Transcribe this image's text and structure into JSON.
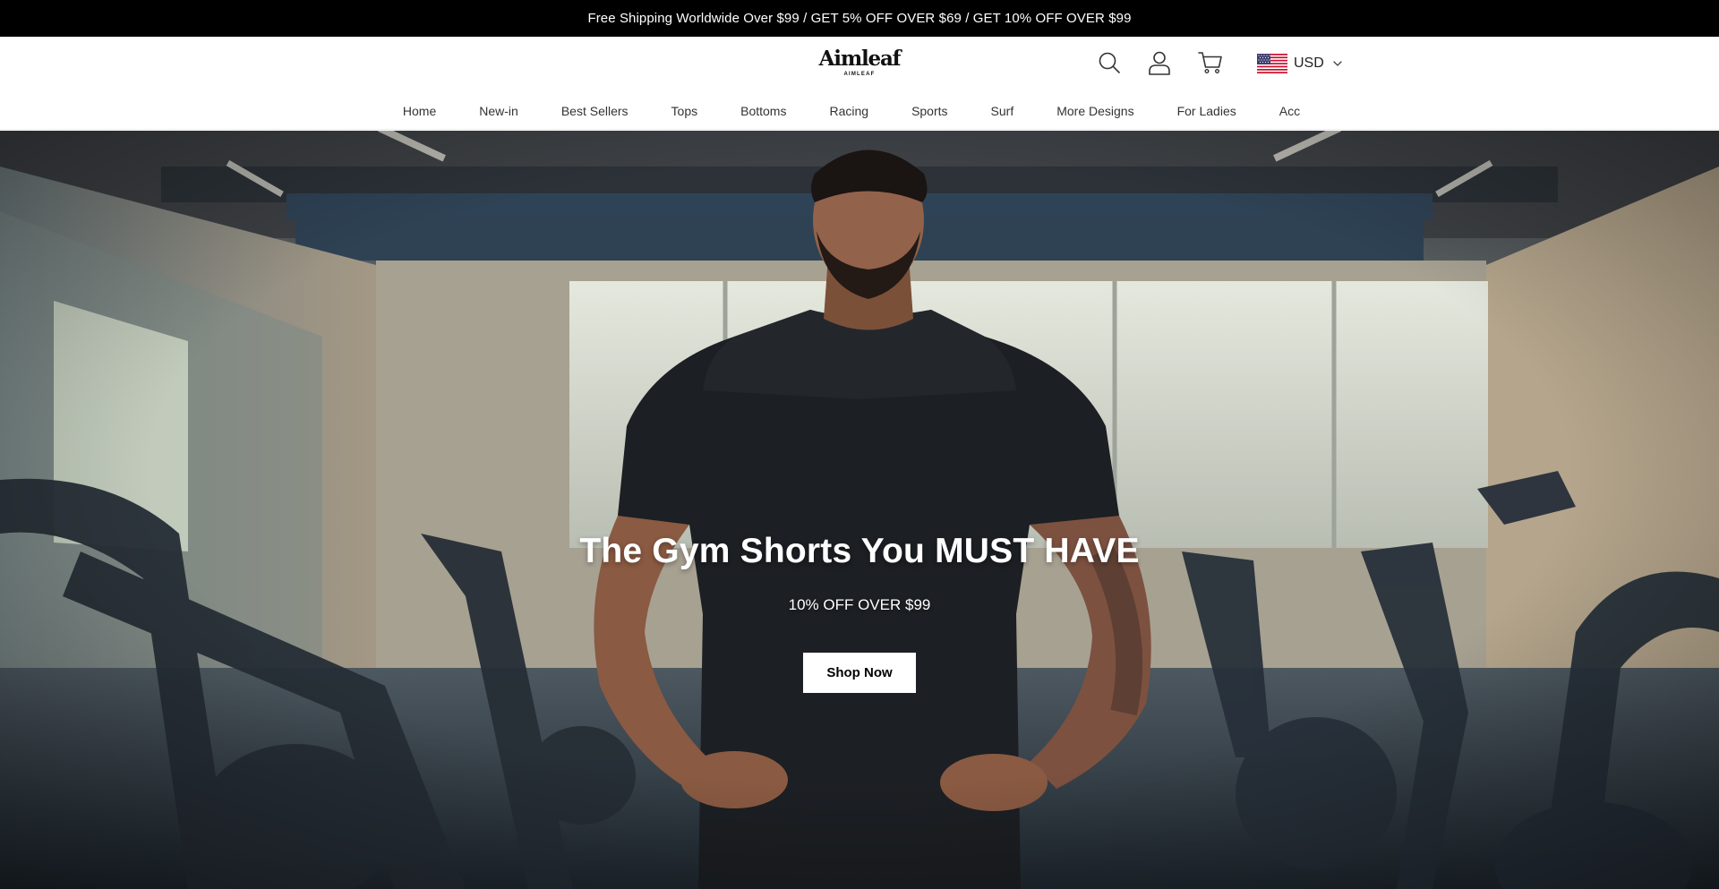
{
  "announcement": "Free Shipping Worldwide Over $99 / GET 5% OFF OVER $69 / GET 10% OFF OVER $99",
  "header": {
    "logo_text": "Aimleaf",
    "logo_sub": "AIMLEAF",
    "currency": "USD",
    "icons": [
      "search-icon",
      "account-icon",
      "cart-icon",
      "us-flag-icon",
      "chevron-down-icon"
    ]
  },
  "nav": {
    "items": [
      "Home",
      "New-in",
      "Best Sellers",
      "Tops",
      "Bottoms",
      "Racing",
      "Sports",
      "Surf",
      "More Designs",
      "For Ladies",
      "Acc"
    ]
  },
  "hero": {
    "title": "The Gym Shorts You MUST HAVE",
    "subtitle": "10% OFF OVER $99",
    "cta": "Shop Now"
  },
  "colors": {
    "announcement_bg": "#000000",
    "button_bg": "#ffffff",
    "hero_text": "#ffffff"
  }
}
